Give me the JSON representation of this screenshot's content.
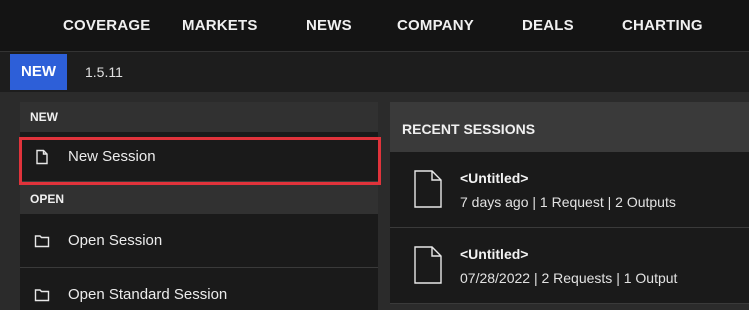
{
  "topnav": {
    "items": [
      "COVERAGE",
      "MARKETS",
      "NEWS",
      "COMPANY",
      "DEALS",
      "CHARTING"
    ]
  },
  "version_bar": {
    "badge": "NEW",
    "version": "1.5.11"
  },
  "left_panel": {
    "new_header": "NEW",
    "new_items": [
      {
        "label": "New Session",
        "icon": "file-icon"
      }
    ],
    "open_header": "OPEN",
    "open_items": [
      {
        "label": "Open Session",
        "icon": "folder-icon"
      },
      {
        "label": "Open Standard Session",
        "icon": "folder-icon"
      }
    ]
  },
  "right_panel": {
    "header": "RECENT SESSIONS",
    "sessions": [
      {
        "title": "<Untitled>",
        "meta": "7 days ago | 1 Request | 2 Outputs"
      },
      {
        "title": "<Untitled>",
        "meta": "07/28/2022 | 2 Requests | 1 Output"
      }
    ]
  },
  "colors": {
    "badge": "#2d5fd8",
    "highlight": "#e0333b"
  }
}
